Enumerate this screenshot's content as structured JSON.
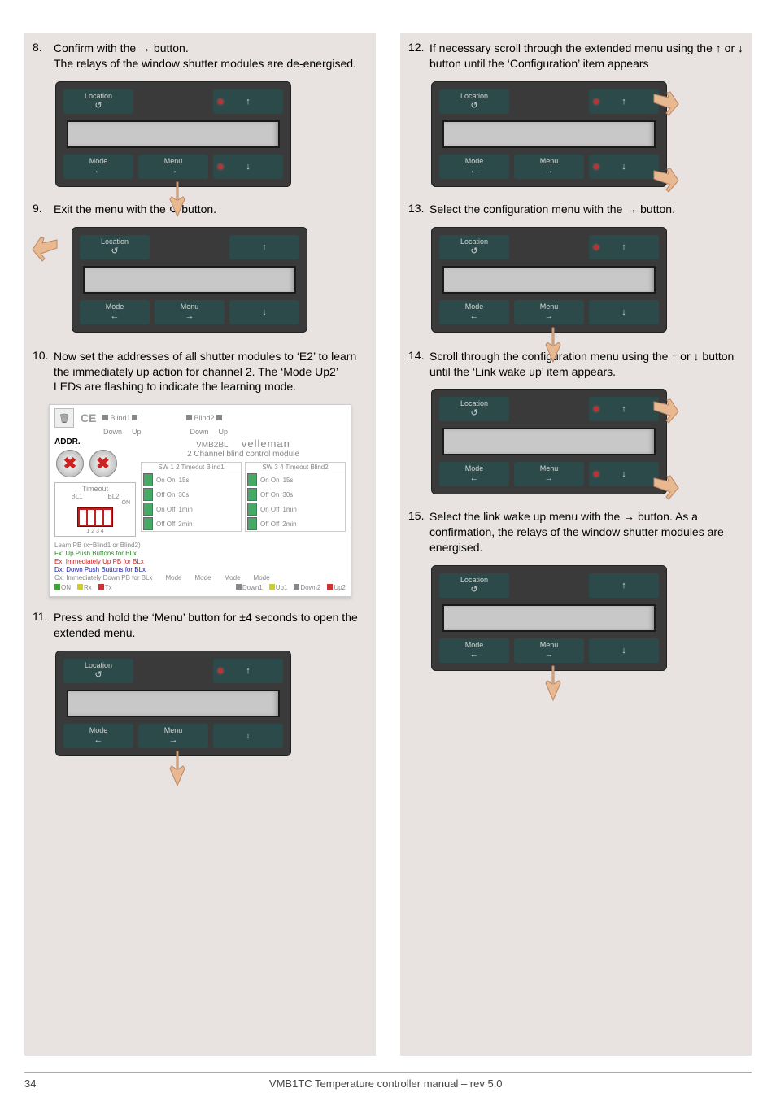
{
  "steps": {
    "s8": {
      "num": "8.",
      "text1": "Confirm with the → button.",
      "text2": "The relays of the window shutter modules are de-energised."
    },
    "s9": {
      "num": "9.",
      "text1": "Exit the menu with the ↺ button."
    },
    "s10": {
      "num": "10.",
      "text1": "Now set the addresses of all shutter modules to ‘E2’ to learn the immediately up action for channel 2. The ‘Mode Up2’ LEDs are flashing to indicate the learning mode."
    },
    "s11": {
      "num": "11.",
      "text1": "Press and hold the ‘Menu’ button for ±4 seconds to open the extended menu."
    },
    "s12": {
      "num": "12.",
      "text1": "If necessary scroll through the extended menu using the ↑ or ↓ button until the ‘Configuration’ item appears"
    },
    "s13": {
      "num": "13.",
      "text1": "Select the configuration menu with the → button."
    },
    "s14": {
      "num": "14.",
      "text1": "Scroll through the configuration menu using the ↑ or ↓ button until the ‘Link wake up’ item appears."
    },
    "s15": {
      "num": "15.",
      "text1": "Select the link wake up menu with the → button. As a confirmation, the relays of the window shutter modules are energised."
    }
  },
  "device": {
    "location": "Location",
    "loc_sym": "↺",
    "mode": "Mode",
    "mode_sym": "←",
    "menu": "Menu",
    "menu_sym": "→",
    "up": "↑",
    "down": "↓"
  },
  "module": {
    "ce": "CE",
    "blind1": "Blind1",
    "blind2": "Blind2",
    "down": "Down",
    "up_l": "Up",
    "addr": "ADDR.",
    "vmb": "VMB2BL",
    "brand": "velleman",
    "subtitle": "2 Channel blind control module",
    "timeout": "Timeout",
    "bl1": "BL1",
    "bl2": "BL2",
    "dips": "1 2 3 4",
    "on_l": "ON",
    "sw12": "SW 1 2 Timeout Blind1",
    "sw34": "SW 3 4 Timeout Blind2",
    "rows": [
      {
        "a": "On On",
        "b": "15s"
      },
      {
        "a": "Off On",
        "b": "30s"
      },
      {
        "a": "On Off",
        "b": "1min"
      },
      {
        "a": "Off Off",
        "b": "2min"
      }
    ],
    "learn_title": "Learn PB (x=Blind1 or Blind2)",
    "learn_fx": "Fx: Up Push Buttons for BLx",
    "learn_ex": "Ex: Immediately Up PB for BLx",
    "learn_dx": "Dx: Down Push Buttons for BLx",
    "learn_cx": "Cx: Immediately Down PB for BLx",
    "mode_l": "Mode",
    "on_led": "ON",
    "rx": "Rx",
    "tx": "Tx",
    "down1": "Down1",
    "up1": "Up1",
    "down2": "Down2",
    "up2": "Up2"
  },
  "footer": {
    "page": "34",
    "title": "VMB1TC Temperature controller manual – rev 5.0"
  }
}
